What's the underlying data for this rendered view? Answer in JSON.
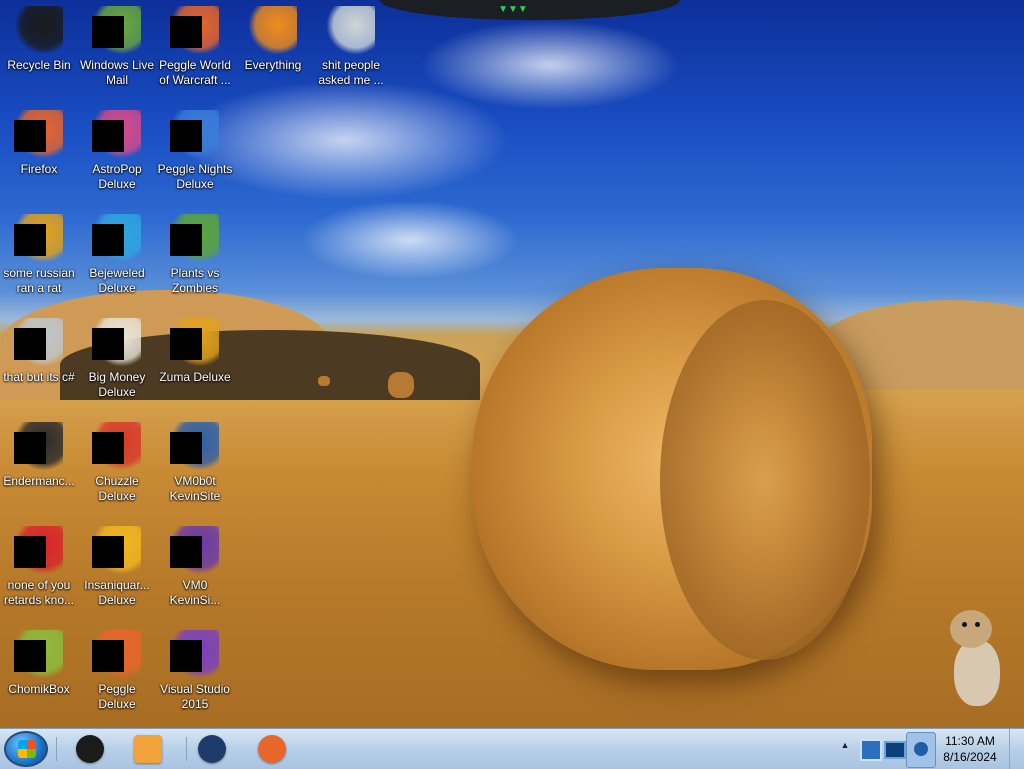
{
  "desktop_icons": [
    {
      "label": "Recycle Bin",
      "icon": "recycle-bin-icon",
      "color": "#1a1a1a"
    },
    {
      "label": "Windows Live Mail",
      "icon": "mail-icon",
      "color": "#6aa93d"
    },
    {
      "label": "Peggle World of Warcraft ...",
      "icon": "peggle-icon",
      "color": "#e8652b"
    },
    {
      "label": "Everything",
      "icon": "search-icon",
      "color": "#f08c1a"
    },
    {
      "label": "shit people asked me ...",
      "icon": "folder-icon",
      "color": "#cfd6d8"
    },
    {
      "label": "Firefox",
      "icon": "firefox-icon",
      "color": "#e8652b"
    },
    {
      "label": "AstroPop Deluxe",
      "icon": "game-icon",
      "color": "#d94a8c"
    },
    {
      "label": "Peggle Nights Deluxe",
      "icon": "peggle-icon",
      "color": "#3b7dd8"
    },
    {
      "label": "some russian ran a rat",
      "icon": "shortcut-icon",
      "color": "#e3a21a"
    },
    {
      "label": "Bejeweled Deluxe",
      "icon": "gem-icon",
      "color": "#2ea6e0"
    },
    {
      "label": "Plants vs Zombies",
      "icon": "flower-icon",
      "color": "#5aa63a"
    },
    {
      "label": "that but its c#",
      "icon": "document-icon",
      "color": "#bfc6cc"
    },
    {
      "label": "Big Money Deluxe",
      "icon": "money-icon",
      "color": "#e9e4d7"
    },
    {
      "label": "Zuma Deluxe",
      "icon": "frog-icon",
      "color": "#e0a21e"
    },
    {
      "label": "Endermanc...",
      "icon": "terminal-icon",
      "color": "#2a2a2a"
    },
    {
      "label": "Chuzzle Deluxe",
      "icon": "chuzzle-icon",
      "color": "#d63a2a"
    },
    {
      "label": "VM0b0t KevinSite",
      "icon": "monitor-icon",
      "color": "#2d5fa8"
    },
    {
      "label": "none of you retards kno...",
      "icon": "opera-icon",
      "color": "#d8242a"
    },
    {
      "label": "Insaniquar... Deluxe",
      "icon": "fish-icon",
      "color": "#f2b720"
    },
    {
      "label": "VM0 KevinSi...",
      "icon": "vs-icon",
      "color": "#6a3aa8"
    },
    {
      "label": "ChomikBox",
      "icon": "hamster-icon",
      "color": "#8ebc3e"
    },
    {
      "label": "Peggle Deluxe",
      "icon": "peggle-icon",
      "color": "#e8652b"
    },
    {
      "label": "Visual Studio 2015",
      "icon": "visual-studio-icon",
      "color": "#7a3fc0"
    }
  ],
  "taskbar": {
    "start_icon": "windows-start-icon",
    "pinned": [
      {
        "icon": "media-center-icon",
        "color": "#1b1b1b"
      },
      {
        "icon": "media-player-icon",
        "color": "#f2a23a"
      },
      {
        "icon": "globe-icon",
        "color": "#1f3b6b"
      },
      {
        "icon": "firefox-icon",
        "color": "#e8652b"
      }
    ],
    "tray": {
      "show_hidden": "▲",
      "icons": [
        "network-icon",
        "display-icon",
        "app-icon"
      ],
      "time": "11:30 AM",
      "date": "8/16/2024"
    }
  },
  "widgets": {
    "hamster": "hamster-gadget-icon",
    "top_led": "▼▼▼"
  }
}
